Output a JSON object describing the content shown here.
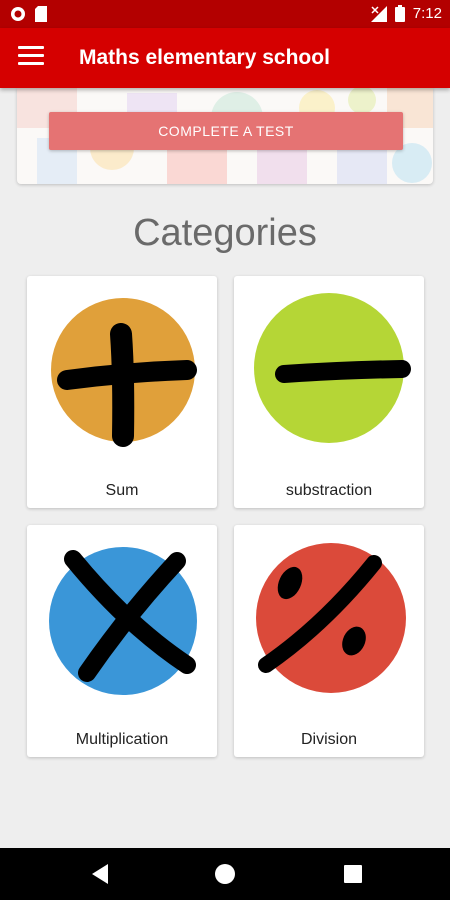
{
  "status_bar": {
    "time": "7:12",
    "icons": [
      "notification-icon",
      "sd-card-icon",
      "signal-icon",
      "battery-icon"
    ]
  },
  "app_bar": {
    "title": "Maths elementary school",
    "menu_icon": "hamburger-menu-icon"
  },
  "banner": {
    "button_label": "COMPLETE A TEST"
  },
  "categories_title": "Categories",
  "categories": [
    {
      "label": "Sum",
      "icon": "plus-icon",
      "color": "#e0a03a"
    },
    {
      "label": "substraction",
      "icon": "minus-icon",
      "color": "#b5d636"
    },
    {
      "label": "Multiplication",
      "icon": "multiply-icon",
      "color": "#3a96d8"
    },
    {
      "label": "Division",
      "icon": "percent-icon",
      "color": "#db4a3a"
    }
  ],
  "nav": {
    "icons": [
      "back-icon",
      "home-icon",
      "recents-icon"
    ]
  }
}
